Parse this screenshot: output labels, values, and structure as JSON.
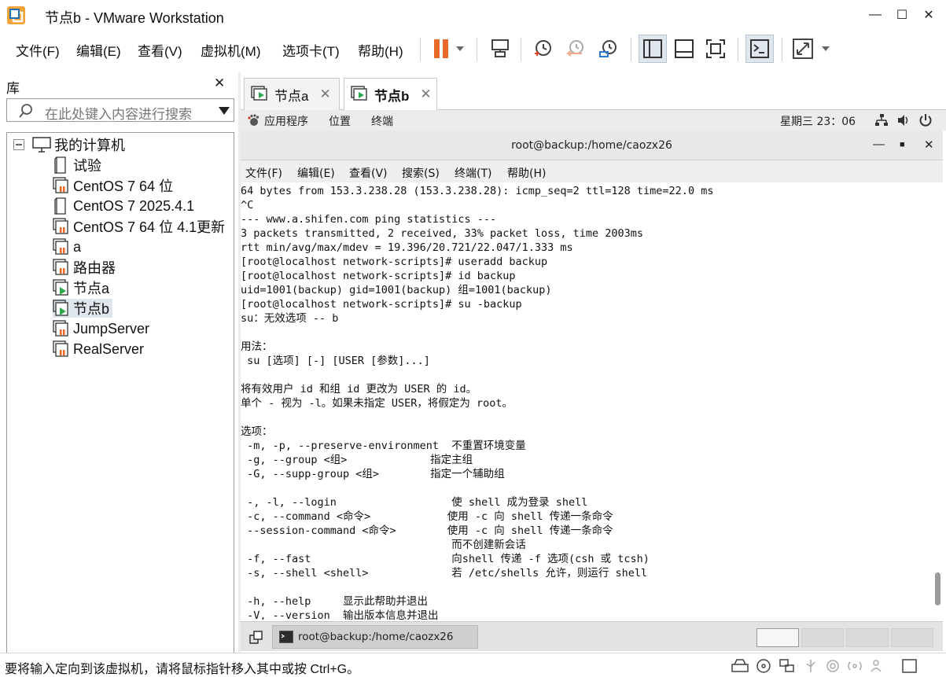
{
  "window": {
    "title": "节点b - VMware Workstation"
  },
  "menubar": {
    "items": [
      "文件(F)",
      "编辑(E)",
      "查看(V)",
      "虚拟机(M)",
      "选项卡(T)",
      "帮助(H)"
    ]
  },
  "library": {
    "title": "库",
    "search_placeholder": "在此处键入内容进行搜索",
    "root": "我的计算机",
    "items": [
      "试验",
      "CentOS 7 64 位",
      "CentOS 7 2025.4.1",
      "CentOS 7 64 位 4.1更新",
      "a",
      "路由器",
      "节点a",
      "节点b",
      "JumpServer",
      "RealServer"
    ]
  },
  "tabs": [
    {
      "label": "节点a"
    },
    {
      "label": "节点b"
    }
  ],
  "gnome": {
    "apps": "应用程序",
    "places": "位置",
    "terminal": "终端",
    "clock": "星期三 23：06"
  },
  "terminal": {
    "title": "root@backup:/home/caozx26",
    "menu": [
      "文件(F)",
      "编辑(E)",
      "查看(V)",
      "搜索(S)",
      "终端(T)",
      "帮助(H)"
    ],
    "lines": [
      "64 bytes from 153.3.238.28 (153.3.238.28): icmp_seq=2 ttl=128 time=22.0 ms",
      "^C",
      "--- www.a.shifen.com ping statistics ---",
      "3 packets transmitted, 2 received, 33% packet loss, time 2003ms",
      "rtt min/avg/max/mdev = 19.396/20.721/22.047/1.333 ms",
      "[root@localhost network-scripts]# useradd backup",
      "[root@localhost network-scripts]# id backup",
      "uid=1001(backup) gid=1001(backup) 组=1001(backup)",
      "[root@localhost network-scripts]# su -backup",
      "su：无效选项 -- b",
      "",
      "用法：",
      " su [选项] [-] [USER [参数]...]",
      "",
      "将有效用户 id 和组 id 更改为 USER 的 id。",
      "单个 - 视为 -l。如果未指定 USER，将假定为 root。",
      "",
      "选项：",
      " -m, -p, --preserve-environment  不重置环境变量",
      " -g, --group <组>             指定主组",
      " -G, --supp-group <组>        指定一个辅助组",
      "",
      " -, -l, --login                  使 shell 成为登录 shell",
      " -c, --command <命令>            使用 -c 向 shell 传递一条命令",
      " --session-command <命令>        使用 -c 向 shell 传递一条命令",
      "                                 而不创建新会话",
      " -f, --fast                      向shell 传递 -f 选项(csh 或 tcsh)",
      " -s, --shell <shell>             若 /etc/shells 允许，则运行 shell",
      "",
      " -h, --help     显示此帮助并退出",
      " -V, --version  输出版本信息并退出"
    ]
  },
  "taskbar": {
    "task": "root@backup:/home/caozx26"
  },
  "statusbar": {
    "text": "要将输入定向到该虚拟机，请将鼠标指针移入其中或按 Ctrl+G。"
  },
  "colors": {
    "pause": "#e8692a",
    "accent": "#2a7bd1",
    "vm_play": "#2fa84f"
  }
}
